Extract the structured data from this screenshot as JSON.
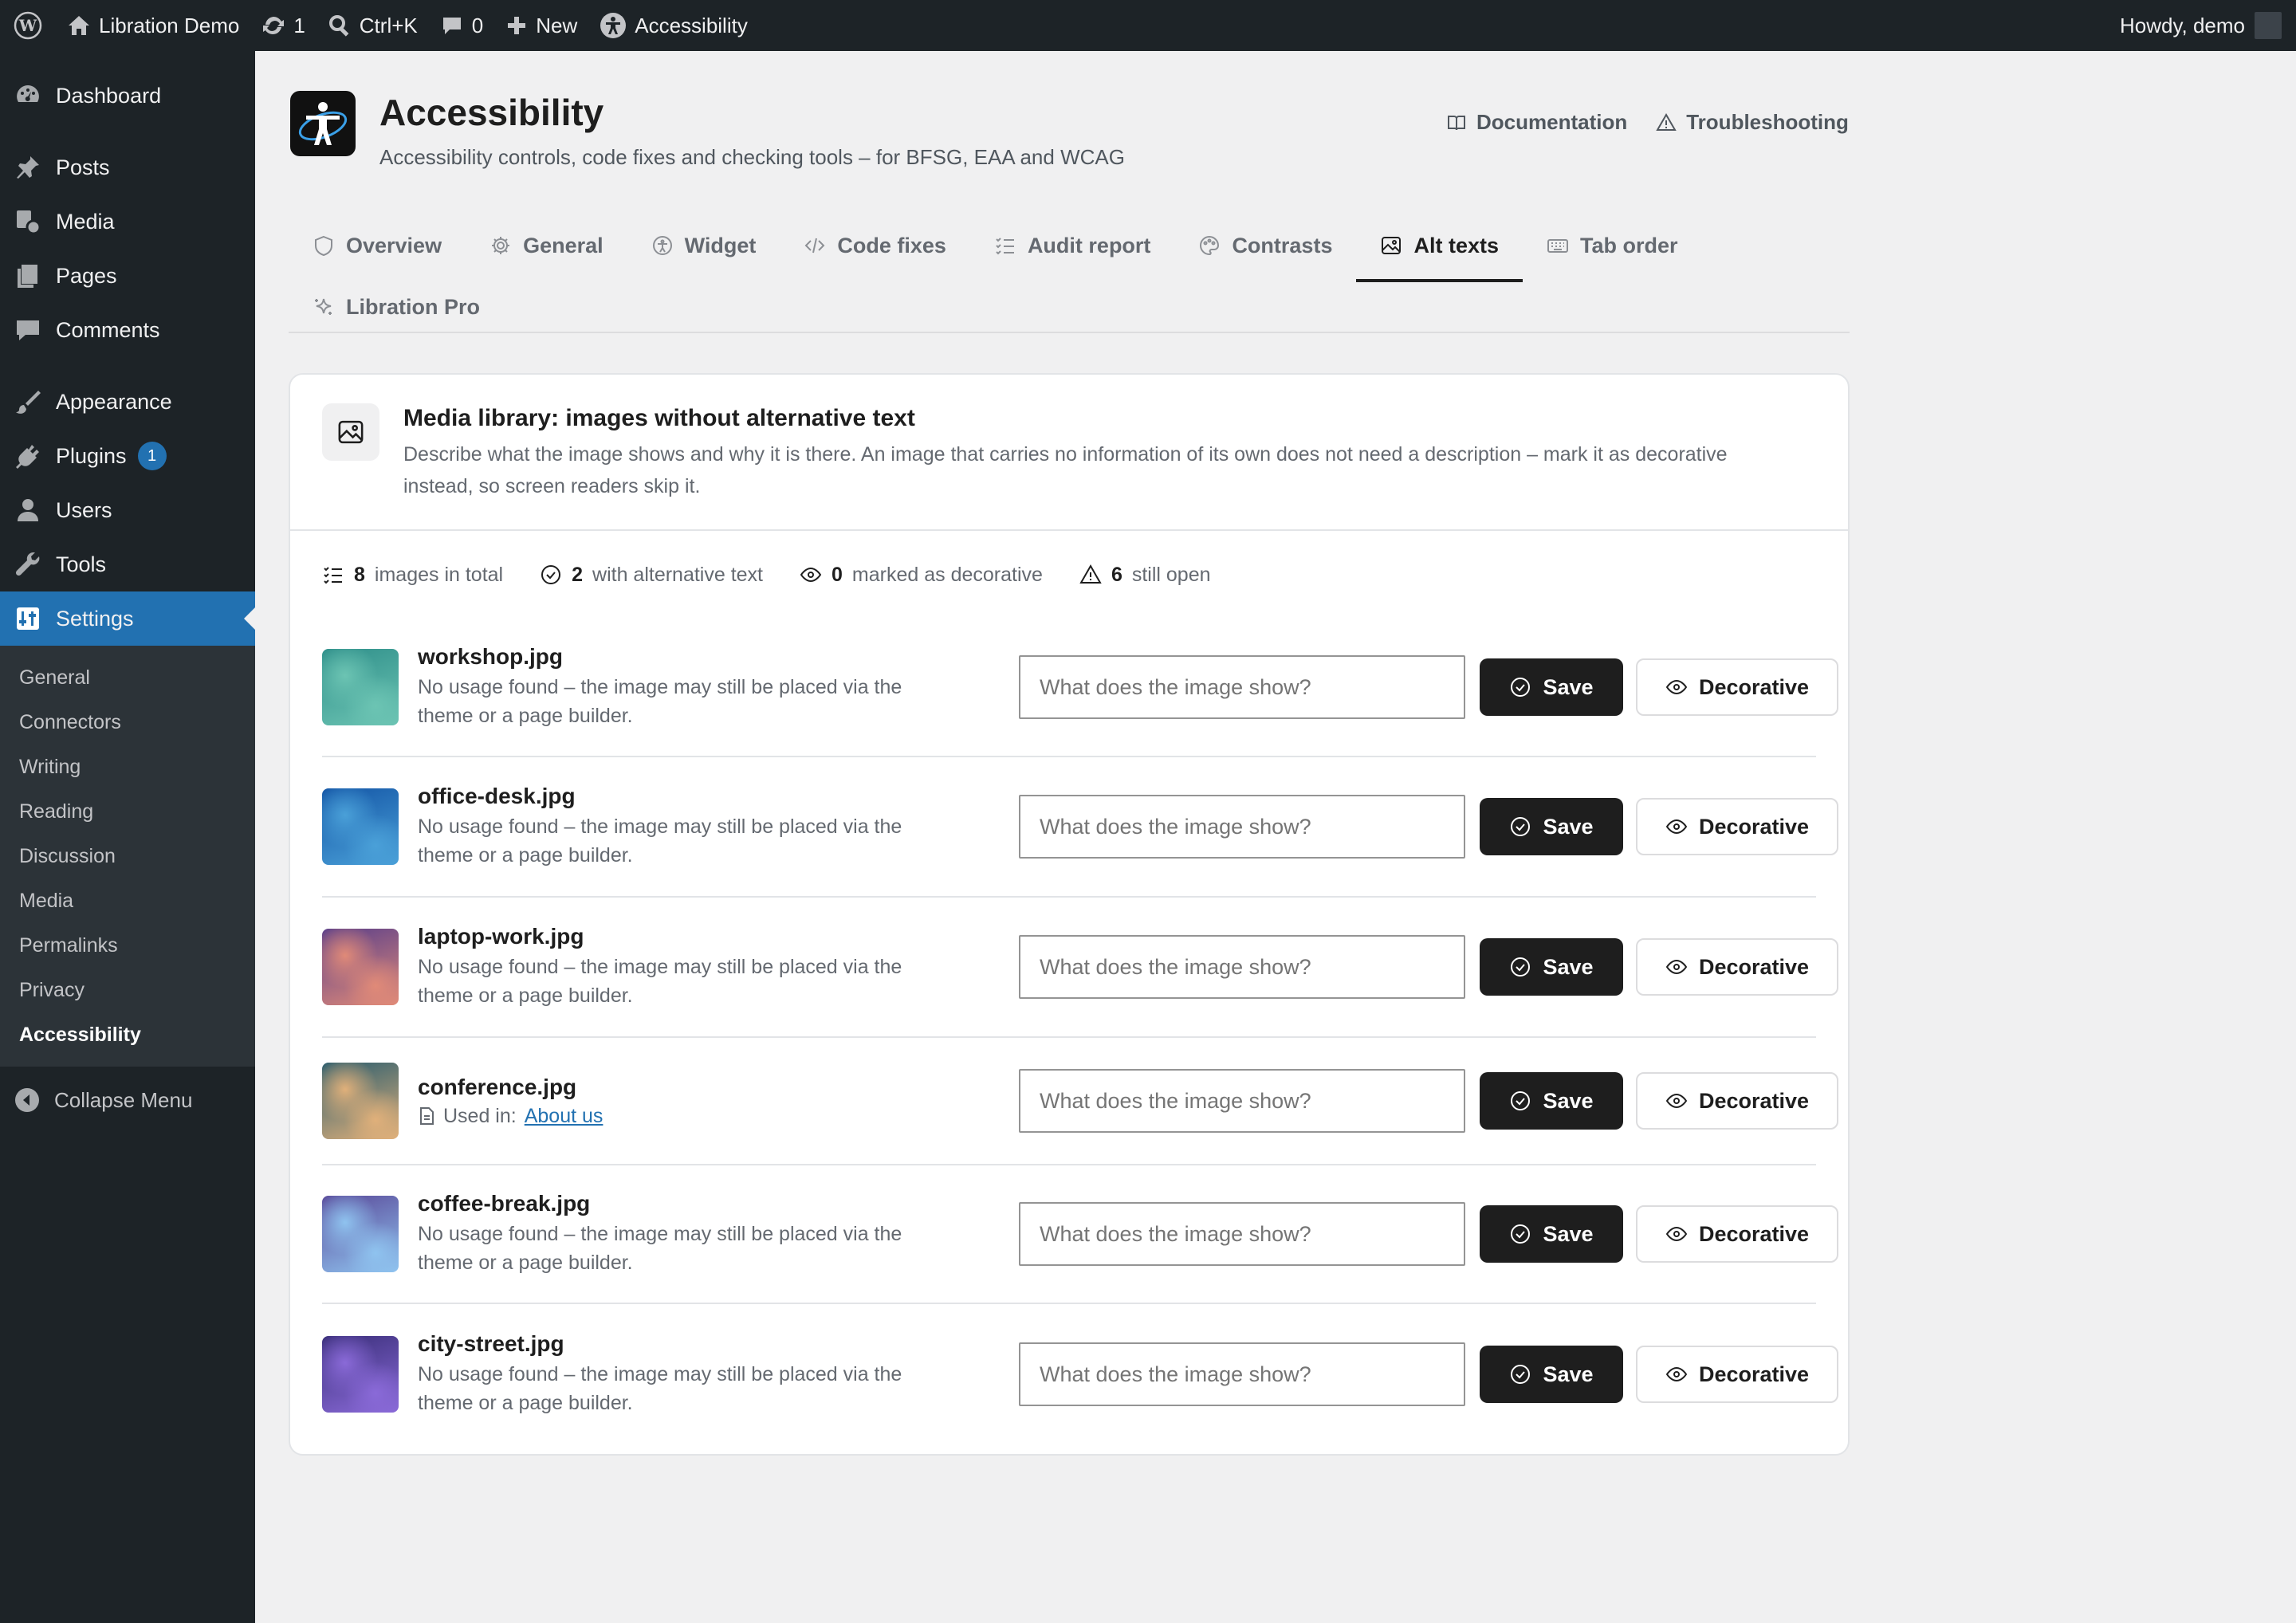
{
  "adminbar": {
    "site_name": "Libration Demo",
    "updates_count": "1",
    "search_shortcut": "Ctrl+K",
    "comments_count": "0",
    "new_label": "New",
    "accessibility_label": "Accessibility",
    "howdy": "Howdy, demo"
  },
  "sidebar": {
    "items": [
      {
        "label": "Dashboard",
        "icon": "dashboard-icon"
      },
      {
        "label": "Posts",
        "icon": "pin-icon"
      },
      {
        "label": "Media",
        "icon": "media-icon"
      },
      {
        "label": "Pages",
        "icon": "pages-icon"
      },
      {
        "label": "Comments",
        "icon": "comment-icon"
      },
      {
        "label": "Appearance",
        "icon": "brush-icon"
      },
      {
        "label": "Plugins",
        "icon": "plug-icon",
        "badge": "1"
      },
      {
        "label": "Users",
        "icon": "user-icon"
      },
      {
        "label": "Tools",
        "icon": "wrench-icon"
      },
      {
        "label": "Settings",
        "icon": "settings-icon",
        "active": true
      }
    ],
    "submenu": [
      "General",
      "Connectors",
      "Writing",
      "Reading",
      "Discussion",
      "Media",
      "Permalinks",
      "Privacy",
      "Accessibility"
    ],
    "current_submenu": "Accessibility",
    "collapse_label": "Collapse Menu"
  },
  "header": {
    "title": "Accessibility",
    "subtitle": "Accessibility controls, code fixes and checking tools – for BFSG, EAA and WCAG",
    "documentation": "Documentation",
    "troubleshooting": "Troubleshooting"
  },
  "tabs": [
    {
      "label": "Overview",
      "icon": "shield-icon"
    },
    {
      "label": "General",
      "icon": "gear-icon"
    },
    {
      "label": "Widget",
      "icon": "accessibility-icon"
    },
    {
      "label": "Code fixes",
      "icon": "code-icon"
    },
    {
      "label": "Audit report",
      "icon": "checklist-icon"
    },
    {
      "label": "Contrasts",
      "icon": "palette-icon"
    },
    {
      "label": "Alt texts",
      "icon": "image-icon",
      "active": true
    },
    {
      "label": "Tab order",
      "icon": "keyboard-icon"
    },
    {
      "label": "Libration Pro",
      "icon": "sparkle-icon"
    }
  ],
  "card": {
    "title": "Media library: images without alternative text",
    "description": "Describe what the image shows and why it is there. An image that carries no information of its own does not need a description – mark it as decorative instead, so screen readers skip it.",
    "stats": [
      {
        "value": "8",
        "label": "images in total",
        "icon": "list-icon"
      },
      {
        "value": "2",
        "label": "with alternative text",
        "icon": "check-circle-icon"
      },
      {
        "value": "0",
        "label": "marked as decorative",
        "icon": "eye-icon"
      },
      {
        "value": "6",
        "label": "still open",
        "icon": "warning-icon"
      }
    ],
    "placeholder": "What does the image show?",
    "save_label": "Save",
    "decorative_label": "Decorative",
    "rows": [
      {
        "filename": "workshop.jpg",
        "usage": "No usage found – the image may still be placed via the theme or a page builder.",
        "colors": [
          "#2f8f8a",
          "#6cc4b3"
        ]
      },
      {
        "filename": "office-desk.jpg",
        "usage": "No usage found – the image may still be placed via the theme or a page builder.",
        "colors": [
          "#1456a6",
          "#4aa0d8"
        ]
      },
      {
        "filename": "laptop-work.jpg",
        "usage": "No usage found – the image may still be placed via the theme or a page builder.",
        "colors": [
          "#5a3f8a",
          "#e08a78"
        ]
      },
      {
        "filename": "conference.jpg",
        "used_in_label": "Used in:",
        "used_in_link": "About us",
        "colors": [
          "#2a5d6e",
          "#e0b07a"
        ]
      },
      {
        "filename": "coffee-break.jpg",
        "usage": "No usage found – the image may still be placed via the theme or a page builder.",
        "colors": [
          "#5a4a9a",
          "#8fc3ef"
        ]
      },
      {
        "filename": "city-street.jpg",
        "usage": "No usage found – the image may still be placed via the theme or a page builder.",
        "colors": [
          "#3a2f7a",
          "#8a6ad8"
        ]
      }
    ]
  }
}
